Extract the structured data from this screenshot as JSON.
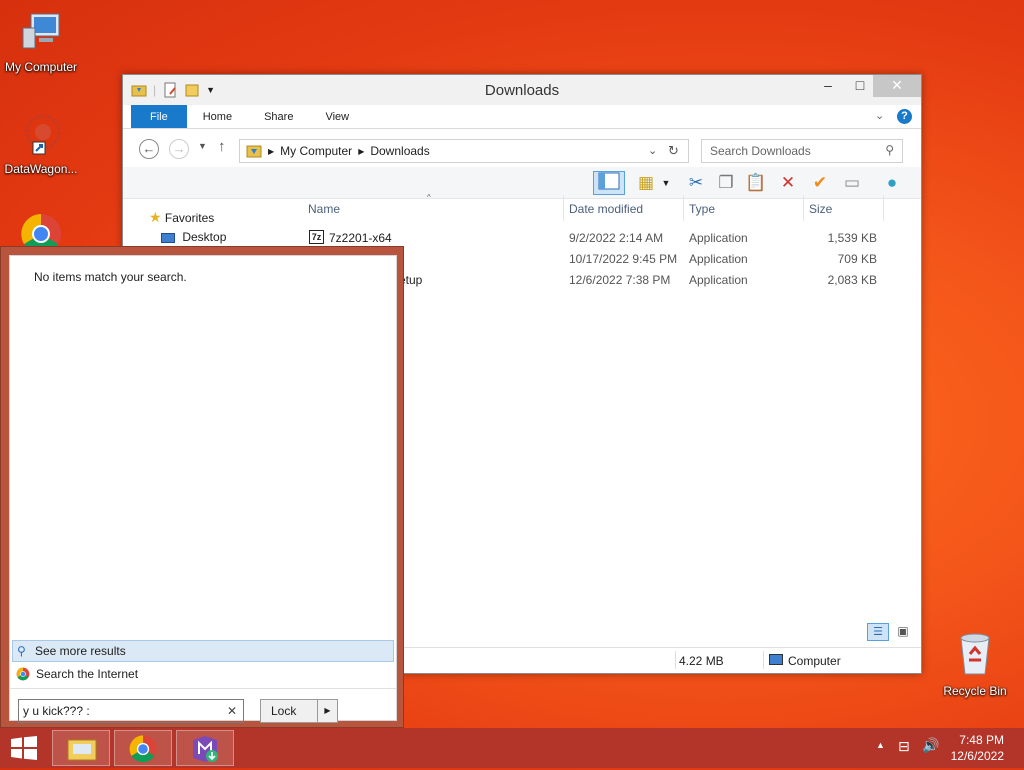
{
  "desktop": {
    "icons": [
      {
        "label": "My Computer"
      },
      {
        "label": "DataWagon..."
      },
      {
        "label": "Recycle Bin"
      }
    ]
  },
  "explorer": {
    "title": "Downloads",
    "tabs": [
      "File",
      "Home",
      "Share",
      "View"
    ],
    "breadcrumb": [
      "My Computer",
      "Downloads"
    ],
    "search_placeholder": "Search Downloads",
    "columns": [
      "Name",
      "Date modified",
      "Type",
      "Size"
    ],
    "nav": {
      "favorites": "Favorites",
      "desktop": "Desktop"
    },
    "files": [
      {
        "name": "7z2201-x64",
        "date": "9/2/2022 2:14 AM",
        "type": "Application",
        "size": "1,539 KB"
      },
      {
        "name": "",
        "date": "10/17/2022 9:45 PM",
        "type": "Application",
        "size": "709 KB"
      },
      {
        "name": "etup",
        "date": "12/6/2022 7:38 PM",
        "type": "Application",
        "size": "2,083 KB"
      }
    ],
    "status": {
      "size": "4.22 MB",
      "location": "Computer"
    }
  },
  "start_search": {
    "no_items": "No items match your search.",
    "see_more": "See more results",
    "search_internet": "Search the Internet",
    "query": "y u kick??? :",
    "lock_label": "Lock"
  },
  "taskbar": {
    "time": "7:48 PM",
    "date": "12/6/2022"
  },
  "colors": {
    "accent": "#1979ca",
    "taskbar": "#b3352a",
    "desktop": "#f4561a"
  }
}
